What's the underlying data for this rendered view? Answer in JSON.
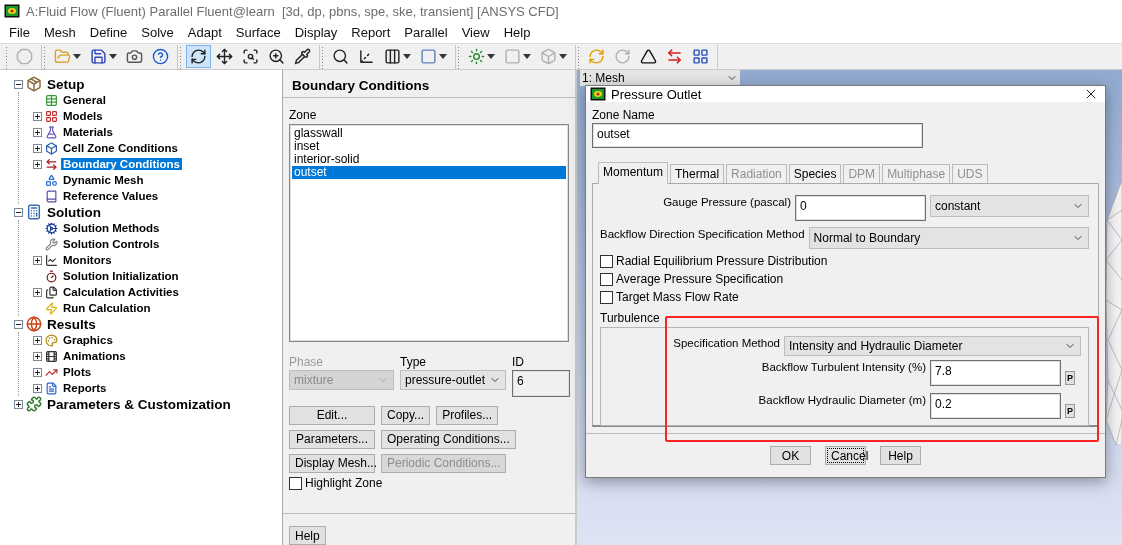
{
  "window": {
    "title": "A:Fluid Flow (Fluent) Parallel Fluent@learn  [3d, dp, pbns, spe, ske, transient] [ANSYS CFD]"
  },
  "menu": [
    "File",
    "Mesh",
    "Define",
    "Solve",
    "Adapt",
    "Surface",
    "Display",
    "Report",
    "Parallel",
    "View",
    "Help"
  ],
  "toolbar": [
    [
      {
        "kind": "stop",
        "selected": false,
        "disabled": true
      }
    ],
    [
      {
        "kind": "open",
        "selected": false,
        "disabled": false,
        "dropdown": true
      },
      {
        "kind": "save",
        "selected": false,
        "disabled": false,
        "dropdown": true
      },
      {
        "kind": "camera",
        "selected": false,
        "disabled": false
      },
      {
        "kind": "help",
        "selected": false,
        "disabled": false
      }
    ],
    [
      {
        "kind": "rotate",
        "selected": true,
        "disabled": false
      },
      {
        "kind": "pan",
        "selected": false,
        "disabled": false
      },
      {
        "kind": "zoomfit",
        "selected": false,
        "disabled": false
      },
      {
        "kind": "zoomin",
        "selected": false,
        "disabled": false
      },
      {
        "kind": "probe",
        "selected": false,
        "disabled": false
      }
    ],
    [
      {
        "kind": "search",
        "selected": false,
        "disabled": false
      },
      {
        "kind": "axes",
        "selected": false,
        "disabled": false
      },
      {
        "kind": "layout",
        "selected": false,
        "disabled": false,
        "dropdown": true
      },
      {
        "kind": "frame",
        "selected": false,
        "disabled": false,
        "dropdown": true
      }
    ],
    [
      {
        "kind": "light",
        "selected": false,
        "disabled": false,
        "dropdown": true
      },
      {
        "kind": "color",
        "selected": false,
        "disabled": true,
        "dropdown": true
      },
      {
        "kind": "cube",
        "selected": false,
        "disabled": true,
        "dropdown": true
      }
    ],
    [
      {
        "kind": "sync",
        "selected": false,
        "disabled": false
      },
      {
        "kind": "refresh",
        "selected": false,
        "disabled": true
      },
      {
        "kind": "logo",
        "selected": false,
        "disabled": false
      },
      {
        "kind": "swap",
        "selected": false,
        "disabled": false
      },
      {
        "kind": "grid",
        "selected": false,
        "disabled": false
      }
    ]
  ],
  "tree": [
    {
      "label": "Setup",
      "expanded": true,
      "selected": false,
      "children": [
        {
          "label": "General",
          "selected": false
        },
        {
          "label": "Models",
          "expanded": false,
          "selected": false
        },
        {
          "label": "Materials",
          "expanded": false,
          "selected": false
        },
        {
          "label": "Cell Zone Conditions",
          "expanded": false,
          "selected": false
        },
        {
          "label": "Boundary Conditions",
          "expanded": false,
          "selected": true
        },
        {
          "label": "Dynamic Mesh",
          "selected": false
        },
        {
          "label": "Reference Values",
          "selected": false
        }
      ]
    },
    {
      "label": "Solution",
      "expanded": true,
      "selected": false,
      "children": [
        {
          "label": "Solution Methods",
          "selected": false
        },
        {
          "label": "Solution Controls",
          "selected": false
        },
        {
          "label": "Monitors",
          "expanded": false,
          "selected": false
        },
        {
          "label": "Solution Initialization",
          "selected": false
        },
        {
          "label": "Calculation Activities",
          "expanded": false,
          "selected": false
        },
        {
          "label": "Run Calculation",
          "selected": false
        }
      ]
    },
    {
      "label": "Results",
      "expanded": true,
      "selected": false,
      "children": [
        {
          "label": "Graphics",
          "expanded": false,
          "selected": false
        },
        {
          "label": "Animations",
          "expanded": false,
          "selected": false
        },
        {
          "label": "Plots",
          "expanded": false,
          "selected": false
        },
        {
          "label": "Reports",
          "expanded": false,
          "selected": false
        }
      ]
    },
    {
      "label": "Parameters & Customization",
      "expanded": false,
      "selected": false
    }
  ],
  "panel": {
    "title": "Boundary Conditions",
    "zone_label": "Zone",
    "zones": [
      {
        "label": "glasswall",
        "selected": false
      },
      {
        "label": "inset",
        "selected": false
      },
      {
        "label": "interior-solid",
        "selected": false
      },
      {
        "label": "outset",
        "selected": true
      }
    ],
    "phase": {
      "label": "Phase",
      "value": "mixture",
      "disabled": true
    },
    "type": {
      "label": "Type",
      "value": "pressure-outlet",
      "disabled": false
    },
    "id": {
      "label": "ID",
      "value": "6"
    },
    "button_rows": [
      [
        {
          "label": "Edit...",
          "disabled": false
        },
        {
          "label": "Copy...",
          "disabled": false
        },
        {
          "label": "Profiles...",
          "disabled": false
        }
      ],
      [
        {
          "label": "Parameters...",
          "disabled": false
        },
        {
          "label": "Operating Conditions...",
          "disabled": false
        }
      ],
      [
        {
          "label": "Display Mesh...",
          "disabled": false
        },
        {
          "label": "Periodic Conditions...",
          "disabled": true
        }
      ]
    ],
    "highlight_zone": {
      "label": "Highlight Zone",
      "checked": false
    },
    "help": "Help"
  },
  "graphics": {
    "window_select": "1: Mesh"
  },
  "dialog": {
    "title": "Pressure Outlet",
    "zone_name_label": "Zone Name",
    "zone_name": "outset",
    "tabs": [
      {
        "label": "Momentum",
        "selected": true,
        "disabled": false
      },
      {
        "label": "Thermal",
        "selected": false,
        "disabled": false
      },
      {
        "label": "Radiation",
        "selected": false,
        "disabled": true
      },
      {
        "label": "Species",
        "selected": false,
        "disabled": false
      },
      {
        "label": "DPM",
        "selected": false,
        "disabled": true
      },
      {
        "label": "Multiphase",
        "selected": false,
        "disabled": true
      },
      {
        "label": "UDS",
        "selected": false,
        "disabled": true
      }
    ],
    "gauge_pressure": {
      "label": "Gauge Pressure (pascal)",
      "value": "0",
      "method": "constant"
    },
    "backflow_direction": {
      "label": "Backflow Direction Specification Method",
      "value": "Normal to Boundary"
    },
    "options": [
      {
        "label": "Radial Equilibrium Pressure Distribution",
        "checked": false
      },
      {
        "label": "Average Pressure Specification",
        "checked": false
      },
      {
        "label": "Target Mass Flow Rate",
        "checked": false
      }
    ],
    "turbulence": {
      "title": "Turbulence",
      "method_label": "Specification Method",
      "method": "Intensity and Hydraulic Diameter",
      "fields": [
        {
          "label": "Backflow Turbulent Intensity (%)",
          "value": "7.8",
          "param": "P"
        },
        {
          "label": "Backflow Hydraulic Diameter (m)",
          "value": "0.2",
          "param": "P"
        }
      ]
    },
    "buttons": [
      {
        "label": "OK",
        "focused": false
      },
      {
        "label": "Cancel",
        "focused": true
      },
      {
        "label": "Help",
        "focused": false
      }
    ]
  }
}
